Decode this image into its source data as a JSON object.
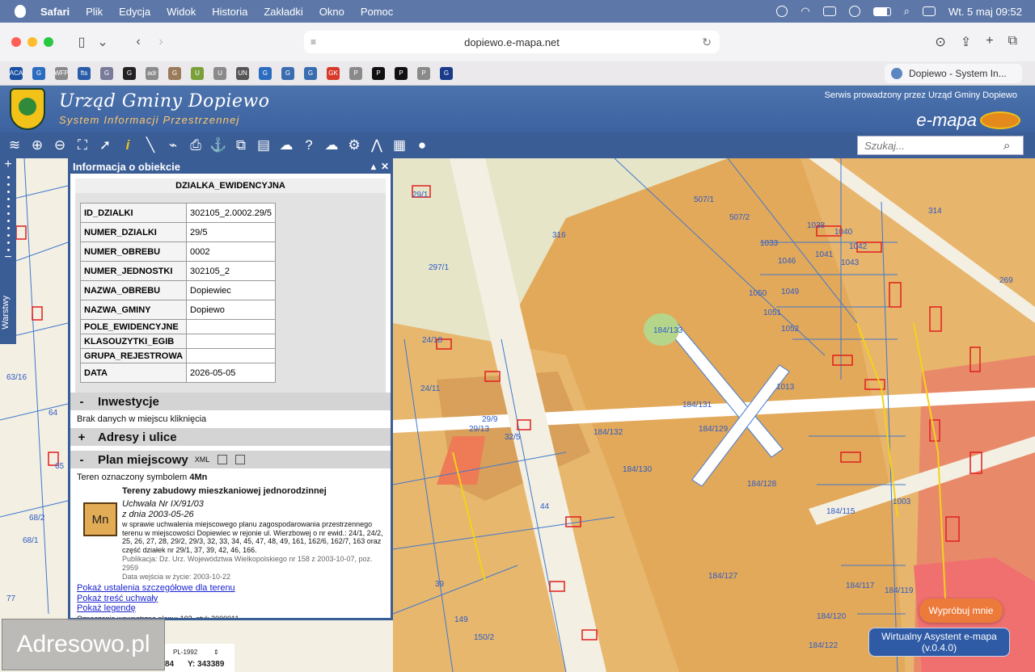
{
  "menubar": {
    "app": "Safari",
    "items": [
      "Plik",
      "Edycja",
      "Widok",
      "Historia",
      "Zakładki",
      "Okno",
      "Pomoc"
    ],
    "clock": "Wt. 5 maj  09:52"
  },
  "browser": {
    "url": "dopiewo.e-mapa.net",
    "tab_title": "Dopiewo - System In...",
    "bookmark_labels": [
      "ACA",
      "G",
      "WFP",
      "fts",
      "G",
      "G",
      "adr",
      "G",
      "U",
      "U",
      "UN",
      "G",
      "G",
      "G",
      "GK",
      "P",
      "P",
      "P",
      "P",
      "G"
    ]
  },
  "header": {
    "title": "Urząd Gminy Dopiewo",
    "subtitle": "System Informacji Przestrzennej",
    "service_note": "Serwis prowadzony przez Urząd Gminy Dopiewo",
    "brand": "e-mapa"
  },
  "toolbar": {
    "search_placeholder": "Szukaj..."
  },
  "layers_tab": "Warstwy",
  "panel": {
    "title": "Informacja o obiekcie",
    "table_title": "DZIALKA_EWIDENCYJNA",
    "rows": [
      {
        "key": "ID_DZIALKI",
        "value": "302105_2.0002.29/5"
      },
      {
        "key": "NUMER_DZIALKI",
        "value": "29/5"
      },
      {
        "key": "NUMER_OBREBU",
        "value": "0002"
      },
      {
        "key": "NUMER_JEDNOSTKI",
        "value": "302105_2"
      },
      {
        "key": "NAZWA_OBREBU",
        "value": "Dopiewiec"
      },
      {
        "key": "NAZWA_GMINY",
        "value": "Dopiewo"
      },
      {
        "key": "POLE_EWIDENCYJNE",
        "value": ""
      },
      {
        "key": "KLASOUZYTKI_EGIB",
        "value": ""
      },
      {
        "key": "GRUPA_REJESTROWA",
        "value": ""
      },
      {
        "key": "DATA",
        "value": "2026-05-05"
      }
    ],
    "sections": {
      "inwestycje": {
        "sign": "-",
        "label": "Inwestycje",
        "text": "Brak danych w miejscu kliknięcia"
      },
      "adresy": {
        "sign": "+",
        "label": "Adresy i ulice"
      },
      "plan": {
        "sign": "-",
        "label": "Plan miejscowy",
        "xml": "XML"
      }
    },
    "plan": {
      "symbol_text": "Teren oznaczony symbolem ",
      "symbol": "4Mn",
      "badge": "Mn",
      "name": "Tereny zabudowy mieszkaniowej jednorodzinnej",
      "resolution": "Uchwała Nr IX/91/03",
      "date": "z dnia 2003-05-26",
      "description": "w sprawie uchwalenia miejscowego planu zagospodarowania przestrzennego terenu w miejscowości Dopiewiec w rejonie ul. Wierzbowej o nr ewid.: 24/1, 24/2, 25, 26, 27, 28, 29/2, 29/3, 32, 33, 34, 45, 47, 48, 49, 161, 162/6, 162/7, 163 oraz część działek nr 29/1, 37, 39, 42, 46, 166.",
      "publication": "Publikacja: Dz. Urz. Województwa Wielkopolskiego nr 158 z 2003-10-07, poz. 2959",
      "effective": "Data wejścia w życie: 2003-10-22"
    },
    "links": [
      "Pokaż ustalenia szczegółowe dla terenu",
      "Pokaż treść uchwały",
      "Pokaż legendę"
    ],
    "internal": "Oznaczenie wewnętrzne planu: 102, styl: 3000011"
  },
  "coords": {
    "system": "PL-1992",
    "x": "84",
    "y": "Y: 343389"
  },
  "watermark": "Adresowo.pl",
  "assistant": {
    "try_label": "Wypróbuj mnie",
    "label": "Wirtualny Asystent e-mapa",
    "version": "(v.0.4.0)"
  },
  "map_labels": [
    "29/1",
    "316",
    "297/1",
    "507/1",
    "507/2",
    "314",
    "1038",
    "1040",
    "1033",
    "1042",
    "1046",
    "1041",
    "1043",
    "269",
    "1050",
    "1049",
    "1051",
    "1052",
    "184/133",
    "184/131",
    "184/132",
    "184/129",
    "184/130",
    "184/128",
    "1013",
    "184/115",
    "184/127",
    "184/117",
    "184/120",
    "184/122",
    "184/119",
    "1003",
    "24/18",
    "24/11",
    "29/13",
    "32/5",
    "29/9",
    "44",
    "39",
    "149",
    "150/2",
    "68/2",
    "68/1",
    "77",
    "64",
    "63/16",
    "65"
  ],
  "colors": {
    "zone_orange": "#e3a95a",
    "parcel_line": "#3f78cf",
    "road_white": "#ffffff",
    "panel_blue": "#3a5d96",
    "accent_orange": "#ec7a3b"
  }
}
